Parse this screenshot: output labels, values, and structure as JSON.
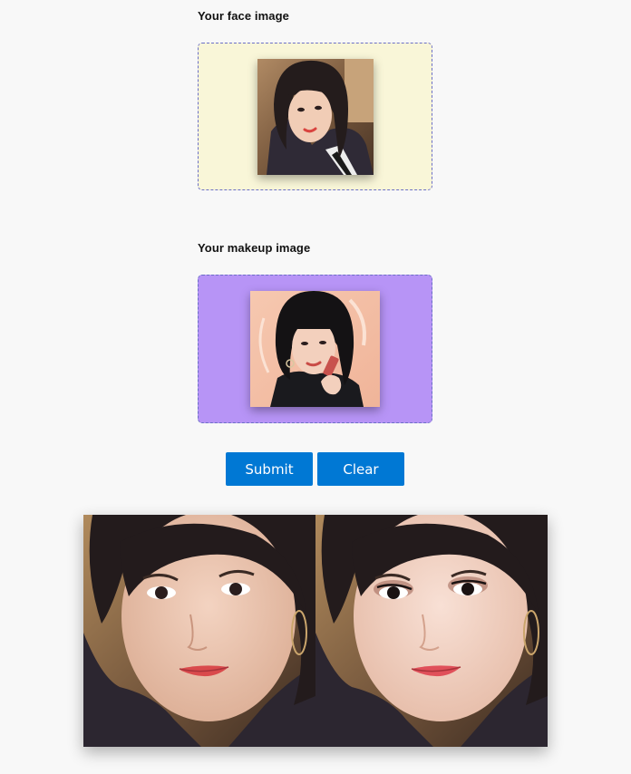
{
  "face_section": {
    "label": "Your face image",
    "dropzone_color": "#f9f6d8",
    "image": "face-photo"
  },
  "makeup_section": {
    "label": "Your makeup image",
    "dropzone_color": "#b794f6",
    "image": "makeup-reference-photo"
  },
  "actions": {
    "submit_label": "Submit",
    "clear_label": "Clear",
    "button_color": "#0078d4"
  },
  "result": {
    "before_image": "face-original",
    "after_image": "face-with-makeup"
  }
}
